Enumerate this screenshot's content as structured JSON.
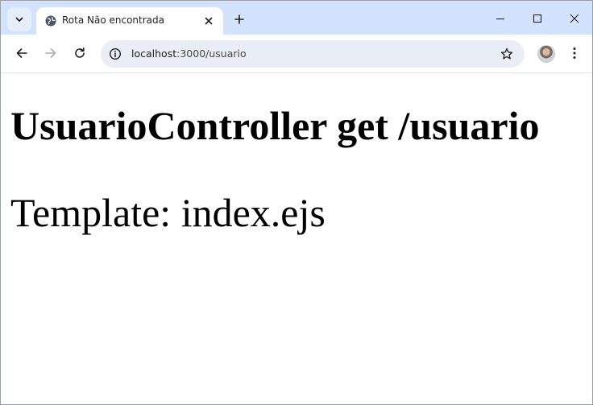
{
  "browser": {
    "tab": {
      "title": "Rota Não encontrada",
      "favicon": "globe-icon",
      "close_icon": "close-icon"
    },
    "new_tab_icon": "plus-icon",
    "tab_search_icon": "chevron-down-icon",
    "window_controls": [
      "minimize-icon",
      "maximize-icon",
      "close-icon"
    ],
    "toolbar": {
      "back_icon": "arrow-left-icon",
      "forward_icon": "arrow-right-icon",
      "reload_icon": "reload-icon",
      "site_info_icon": "site-info-icon",
      "url_host": "localhost",
      "url_rest": ":3000/usuario",
      "bookmark_icon": "star-icon",
      "menu_icon": "kebab-menu-icon"
    },
    "colors": {
      "tabstrip": "#d3e3fd",
      "omnibox": "#e9eef6",
      "text": "#1f1f1f"
    }
  },
  "page": {
    "heading": "UsuarioController get /usuario",
    "paragraph": "Template: index.ejs"
  }
}
